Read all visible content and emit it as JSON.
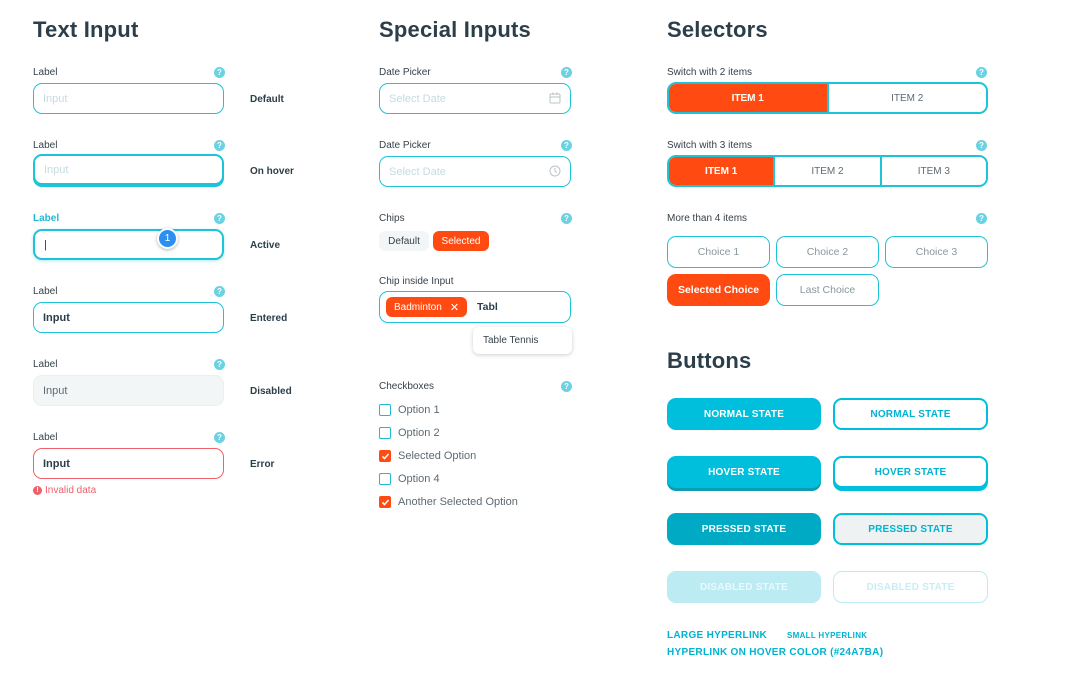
{
  "text_input": {
    "title": "Text Input",
    "rows": [
      {
        "label": "Label",
        "value": "",
        "placeholder": "Input",
        "state": "Default"
      },
      {
        "label": "Label",
        "value": "",
        "placeholder": "Input",
        "state": "On hover"
      },
      {
        "label": "Label",
        "value": "|",
        "placeholder": "",
        "state": "Active"
      },
      {
        "label": "Label",
        "value": "Input",
        "placeholder": "",
        "state": "Entered"
      },
      {
        "label": "Label",
        "value": "Input",
        "placeholder": "",
        "state": "Disabled"
      },
      {
        "label": "Label",
        "value": "Input",
        "placeholder": "",
        "state": "Error"
      }
    ],
    "badge": "1",
    "error_text": "Invalid data",
    "help_glyph": "?"
  },
  "special_inputs": {
    "title": "Special Inputs",
    "date_picker_1": {
      "label": "Date Picker",
      "placeholder": "Select Date",
      "icon": "calendar-icon"
    },
    "date_picker_2": {
      "label": "Date Picker",
      "placeholder": "Select Date",
      "icon": "clock-icon"
    },
    "chips": {
      "label": "Chips",
      "items": [
        "Default",
        "Selected"
      ]
    },
    "chip_input": {
      "label": "Chip inside Input",
      "chip": "Badminton",
      "typed": "Tabl",
      "suggestion": "Table Tennis"
    },
    "checkboxes": {
      "label": "Checkboxes",
      "items": [
        {
          "label": "Option 1",
          "checked": false
        },
        {
          "label": "Option 2",
          "checked": false
        },
        {
          "label": "Selected Option",
          "checked": true
        },
        {
          "label": "Option 4",
          "checked": false
        },
        {
          "label": "Another Selected Option",
          "checked": true
        }
      ]
    }
  },
  "selectors": {
    "title": "Selectors",
    "switch2": {
      "label": "Switch with 2 items",
      "items": [
        "ITEM 1",
        "ITEM 2"
      ]
    },
    "switch3": {
      "label": "Switch with 3 items",
      "items": [
        "ITEM 1",
        "ITEM 2",
        "ITEM 3"
      ]
    },
    "choices": {
      "label": "More than 4 items",
      "items": [
        "Choice 1",
        "Choice 2",
        "Choice 3",
        "Selected Choice",
        "Last Choice"
      ]
    }
  },
  "buttons": {
    "title": "Buttons",
    "normal": "NORMAL STATE",
    "hover": "HOVER STATE",
    "pressed": "PRESSED STATE",
    "disabled": "DISABLED STATE",
    "large_link": "LARGE HYPERLINK",
    "small_link": "SMALL HYPERLINK",
    "hover_link": "HYPERLINK ON HOVER COLOR (#24A7BA)"
  },
  "colors": {
    "accent": "#1fc3d8",
    "selected": "#ff4b12",
    "error": "#f0606a",
    "link_hover": "#24A7BA"
  }
}
